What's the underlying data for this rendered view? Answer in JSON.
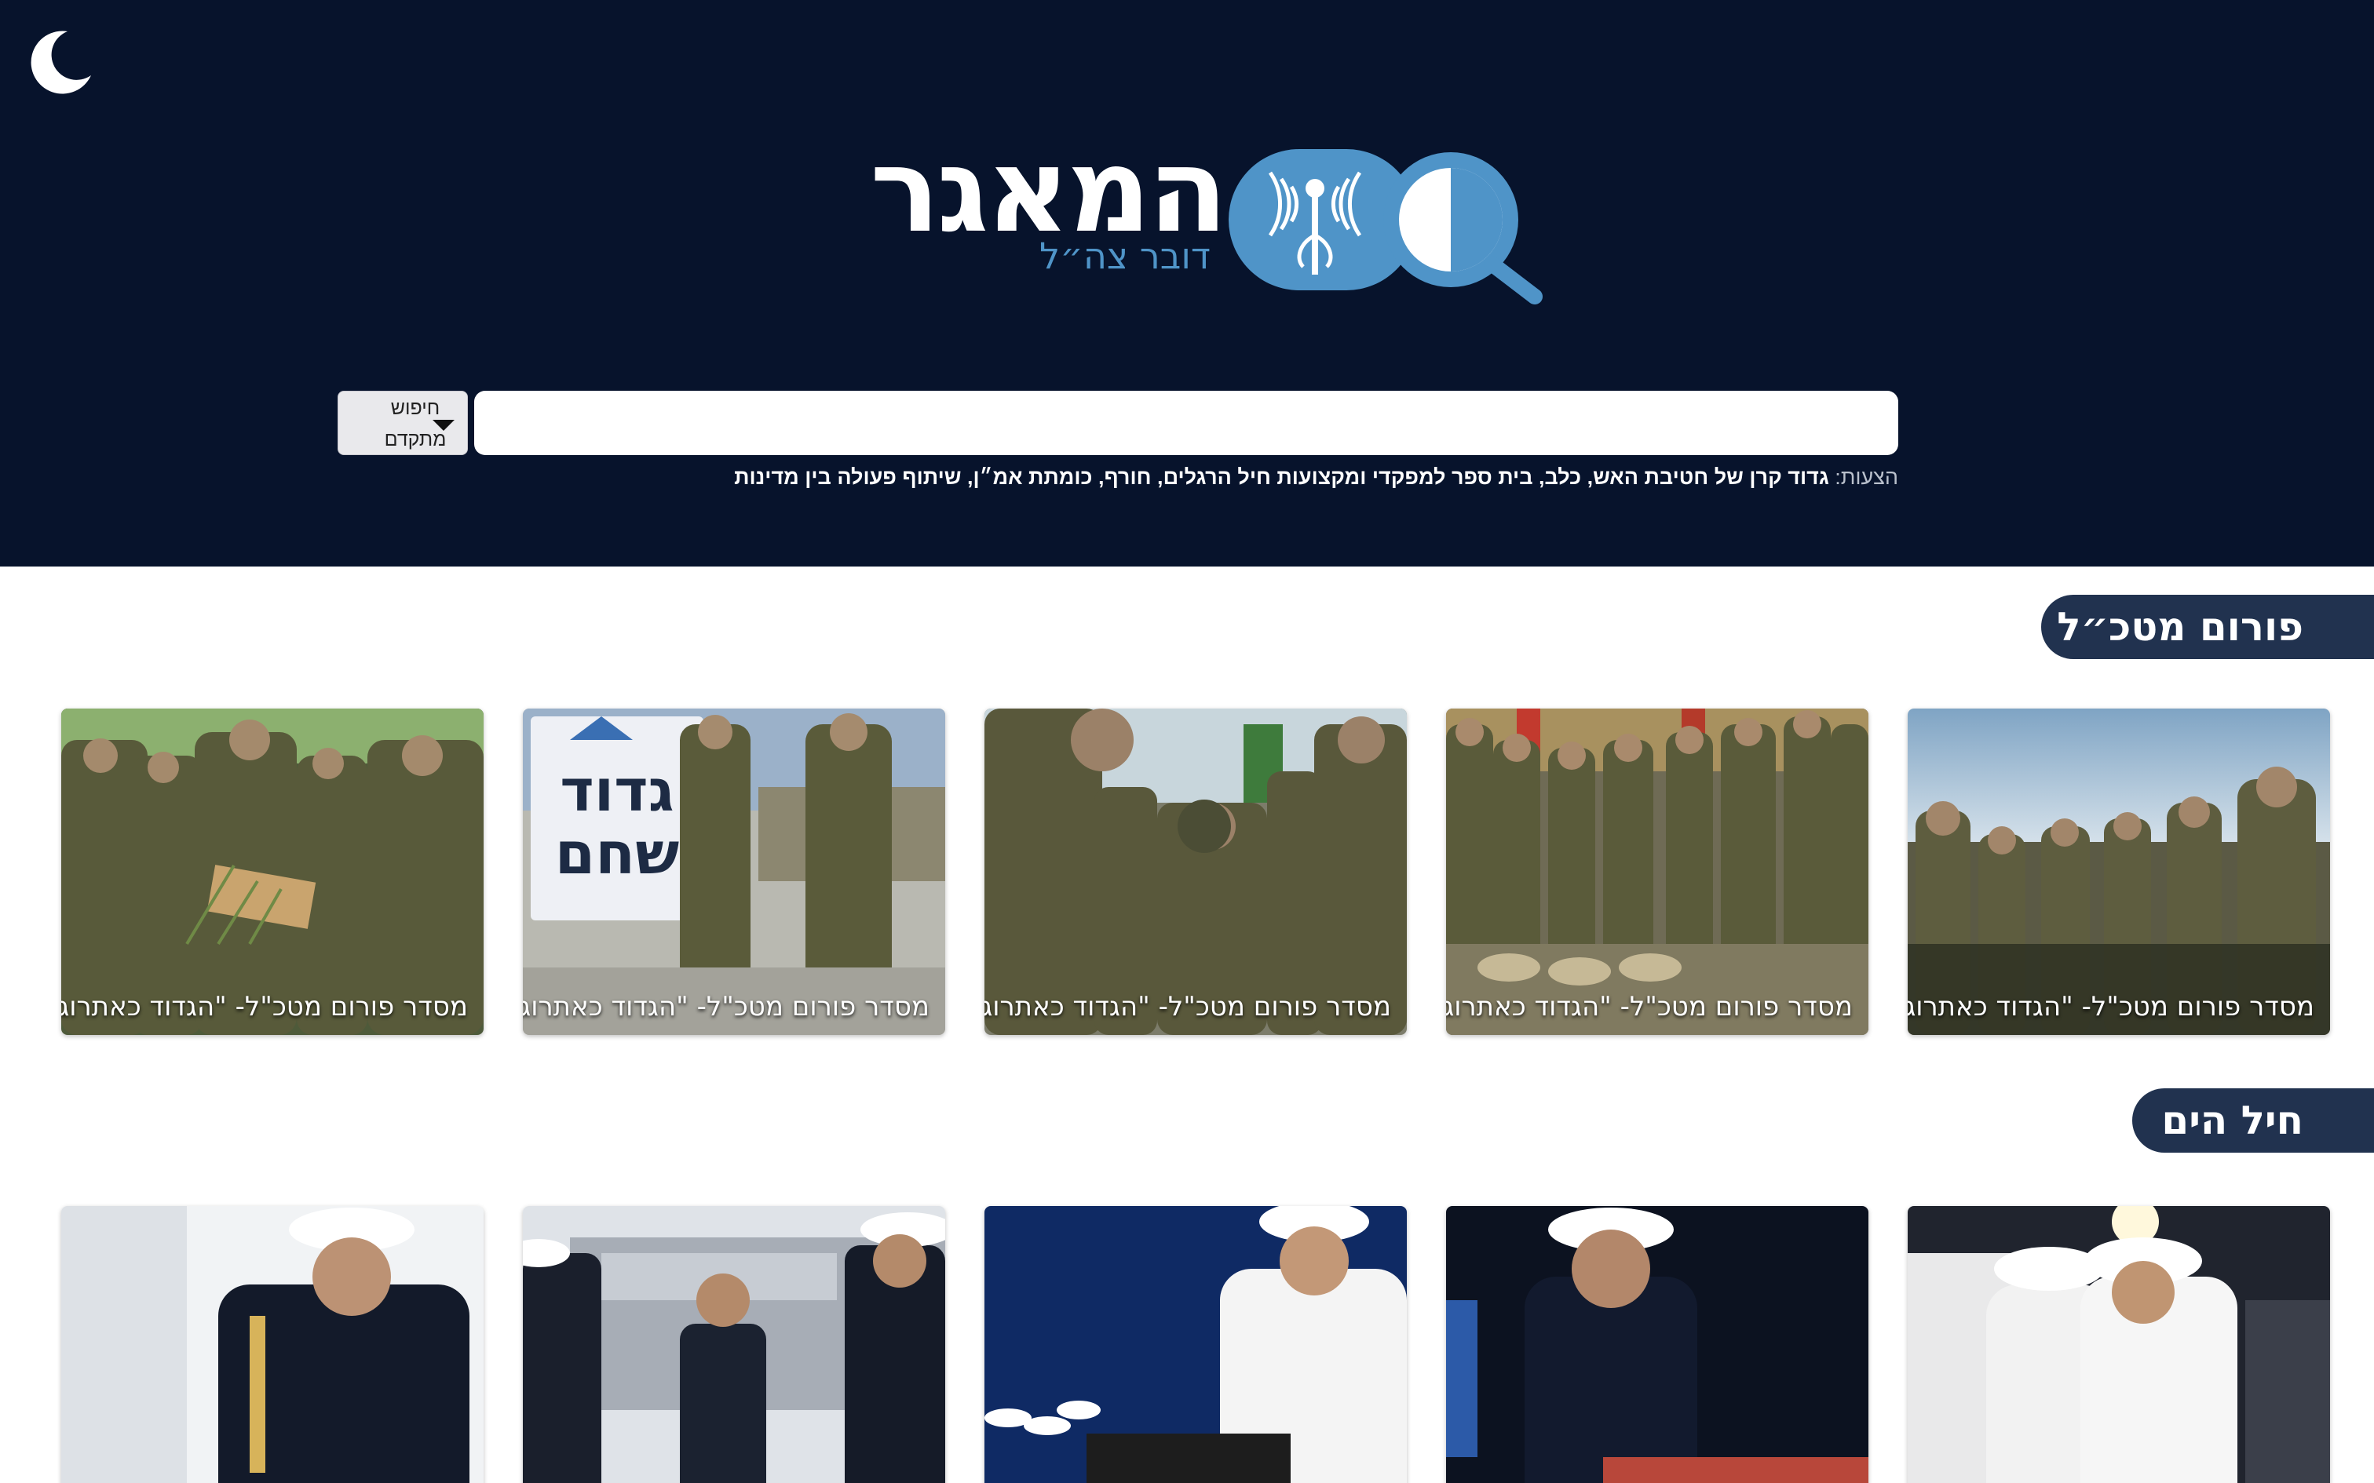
{
  "theme_toggle": {
    "icon": "moon-icon"
  },
  "logo": {
    "title": "המאגר",
    "subtitle": "דובר צה״ל",
    "colors": {
      "primary": "#4f94c8",
      "dark": "#07132c"
    }
  },
  "search": {
    "value": "",
    "advanced_label": "חיפוש מתקדם"
  },
  "suggestions": {
    "label": "הצעות:",
    "items": [
      "גדוד קרן של חטיבת האש",
      "כלב",
      "בית ספר למפקדי ומקצועות חיל הרגלים",
      "חורף",
      "כומתת אמ״ן",
      "שיתוף פעולה בין מדינות"
    ]
  },
  "sections": [
    {
      "title": "פורום מטכ״ל",
      "cards": [
        {
          "caption": "מסדר פורום מטכ\"ל- \"הגדוד כאתרוג\""
        },
        {
          "caption": "מסדר פורום מטכ\"ל- \"הגדוד כאתרוג\""
        },
        {
          "caption": "מסדר פורום מטכ\"ל- \"הגדוד כאתרוג\""
        },
        {
          "caption": "מסדר פורום מטכ\"ל- \"הגדוד כאתרוג\""
        },
        {
          "caption": "מסדר פורום מטכ\"ל- \"הגדוד כאתרוג\""
        }
      ]
    },
    {
      "title": "חיל הים",
      "cards": [
        {
          "caption": ""
        },
        {
          "caption": ""
        },
        {
          "caption": ""
        },
        {
          "caption": ""
        },
        {
          "caption": ""
        }
      ]
    }
  ],
  "sign_text": {
    "line1": "גדוד",
    "line2": "שחם"
  }
}
